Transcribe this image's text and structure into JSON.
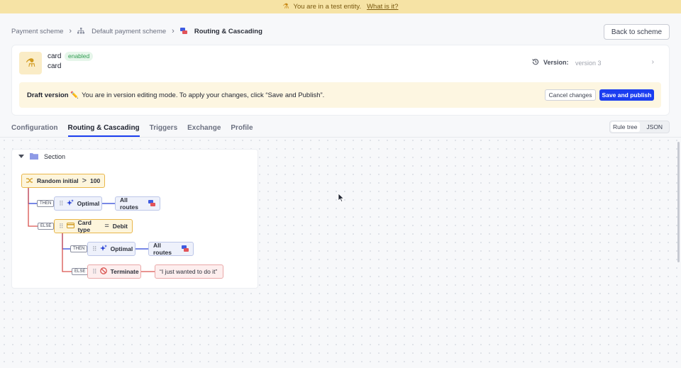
{
  "banner": {
    "text": "You are in a test entity.",
    "link": "What is it?"
  },
  "breadcrumb": {
    "item1": "Payment scheme",
    "item2": "Default payment scheme",
    "item3": "Routing & Cascading"
  },
  "back_button": "Back to scheme",
  "entity": {
    "name": "card",
    "status": "enabled",
    "subtitle": "card"
  },
  "version": {
    "label": "Version:",
    "value": "version 3"
  },
  "draft": {
    "title": "Draft version ✏️",
    "message": "You are in version editing mode. To apply your changes, click “Save and Publish”.",
    "cancel": "Cancel changes",
    "save": "Save and publish"
  },
  "tabs": [
    "Configuration",
    "Routing & Cascading",
    "Triggers",
    "Exchange",
    "Profile"
  ],
  "view_toggle": {
    "tree": "Rule tree",
    "json": "JSON"
  },
  "tree": {
    "section": "Section",
    "root": {
      "label": "Random initial",
      "op": ">",
      "value": "100"
    },
    "then1": {
      "pill": "THEN",
      "strategy": "Optimal",
      "target": "All routes"
    },
    "else1": {
      "pill": "ELSE",
      "label": "Card type",
      "op": "=",
      "value": "Debit"
    },
    "then2": {
      "pill": "THEN",
      "strategy": "Optimal",
      "target": "All routes"
    },
    "else2": {
      "pill": "ELSE",
      "action": "Terminate",
      "message": "“I just wanted to do it”"
    }
  },
  "colors": {
    "accent": "#1b3ef0",
    "warning": "#e9b64a",
    "danger": "#d9534f",
    "success": "#2e9b4f"
  }
}
